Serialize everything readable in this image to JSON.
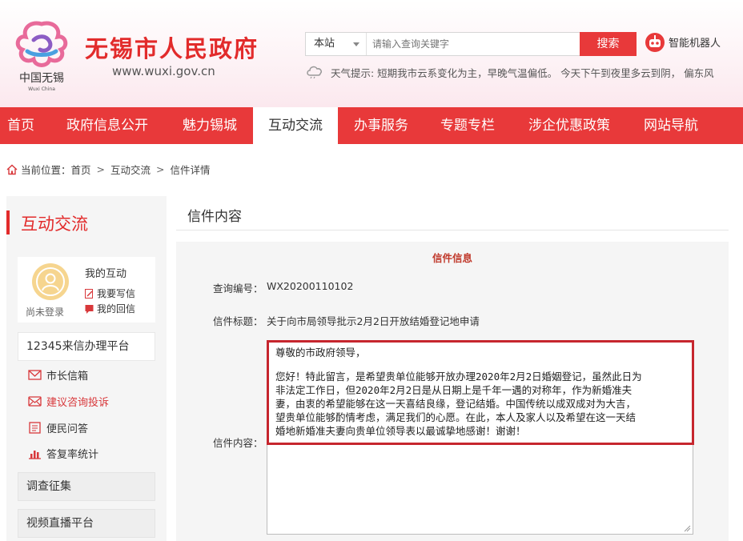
{
  "header": {
    "logo_caption_cn": "中国无锡",
    "logo_caption_en": "Wuxi China",
    "site_name": "无锡市人民政府",
    "site_url": "www.wuxi.gov.cn",
    "search": {
      "scope": "本站",
      "placeholder": "请输入查询关键字",
      "button": "搜索"
    },
    "robot_label": "智能机器人",
    "weather": "天气提示: 短期我市云系变化为主，早晚气温偏低。   今天下午到夜里多云到阴， 偏东风"
  },
  "nav": {
    "items": [
      "首页",
      "政府信息公开",
      "魅力锡城",
      "互动交流",
      "办事服务",
      "专题专栏",
      "涉企优惠政策",
      "网站导航"
    ],
    "active_index": 3
  },
  "breadcrumb": {
    "prefix": "当前位置：",
    "items": [
      "首页",
      "互动交流",
      "信件详情"
    ]
  },
  "sidebar": {
    "title": "互动交流",
    "user": {
      "avatar_label": "尚未登录",
      "my_title": "我的互动",
      "write_letter": "我要写信",
      "my_replies": "我的回信"
    },
    "platform_12345": "12345来信办理平台",
    "items": [
      {
        "label": "市长信箱",
        "icon": "mail-icon"
      },
      {
        "label": "建议咨询投诉",
        "icon": "envelope-icon"
      },
      {
        "label": "便民问答",
        "icon": "qa-icon"
      },
      {
        "label": "答复率统计",
        "icon": "bar-chart-icon"
      }
    ],
    "survey": "调查征集",
    "live": "视频直播平台"
  },
  "main": {
    "title": "信件内容",
    "panel_heading": "信件信息",
    "query_no_label": "查询编号：",
    "query_no": "WX20200110102",
    "subject_label": "信件标题：",
    "subject": "关于向市局领导批示2月2日开放结婚登记地申请",
    "content_label": "信件内容：",
    "content": {
      "salutation": "尊敬的市政府领导，",
      "lines": [
        "您好！特此留言，是希望贵单位能够开放办理2020年2月2日婚姻登记，虽然此日为",
        "非法定工作日，但2020年2月2日是从日期上是千年一遇的对称年，作为新婚准夫",
        "妻，由衷的希望能够在这一天喜结良缘，登记结婚。中国传统以成双成对为大吉，",
        "望贵单位能够酌情考虑，满足我们的心愿。在此，本人及家人以及希望在这一天结",
        "婚地新婚准夫妻向贵单位领导表以最诚挚地感谢！谢谢！"
      ]
    }
  },
  "colors": {
    "brand_red": "#e8393a",
    "title_red": "#e22b2b",
    "highlight_border": "#c6262e"
  }
}
